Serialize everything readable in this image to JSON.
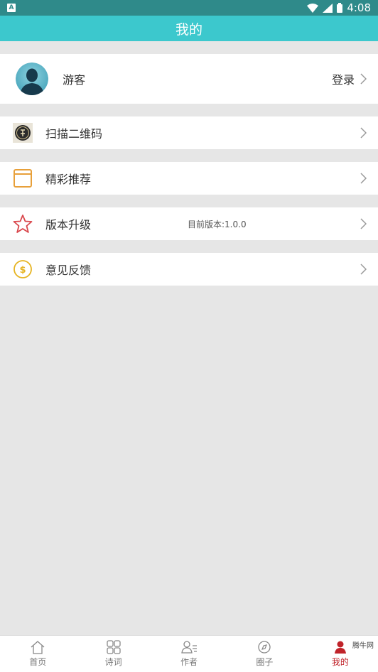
{
  "status_bar": {
    "time": "4:08"
  },
  "title": "我的",
  "profile": {
    "name": "游客",
    "login_label": "登录"
  },
  "menu": [
    {
      "label": "扫描二维码",
      "extra": ""
    },
    {
      "label": "精彩推荐",
      "extra": ""
    },
    {
      "label": "版本升级",
      "extra": "目前版本:1.0.0"
    },
    {
      "label": "意见反馈",
      "extra": ""
    }
  ],
  "tabs": [
    {
      "label": "首页",
      "active": false
    },
    {
      "label": "诗词",
      "active": false
    },
    {
      "label": "作者",
      "active": false
    },
    {
      "label": "圈子",
      "active": false
    },
    {
      "label": "我的",
      "active": true
    }
  ],
  "watermark": "腾牛网",
  "colors": {
    "status_bar": "#2f8a8a",
    "title_bar": "#3cc8cd",
    "active_tab": "#c0232a",
    "background": "#e6e6e6"
  }
}
